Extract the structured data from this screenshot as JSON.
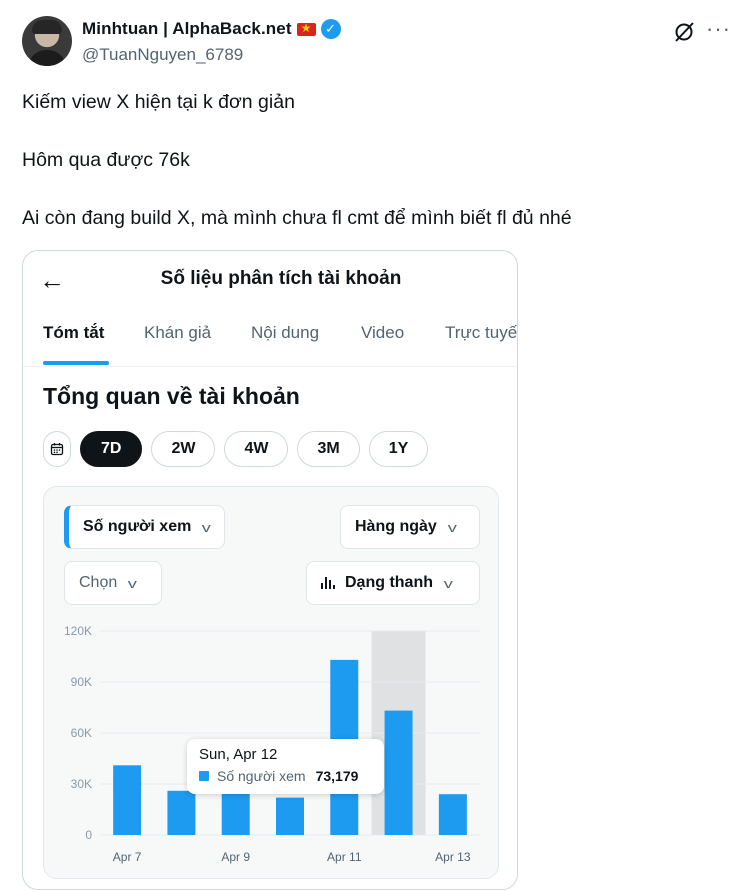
{
  "author": {
    "display_name": "Minhtuan | AlphaBack.net",
    "handle": "@TuanNguyen_6789"
  },
  "post_paragraphs": [
    "Kiếm view X hiện tại k đơn giản",
    "Hôm qua được 76k",
    "Ai còn đang build X, mà mình chưa fl cmt để mình biết fl đủ nhé"
  ],
  "icons": {
    "back": "arrow-left-icon",
    "calendar": "calendar-icon",
    "grok": "grok-icon",
    "more": "more-icon"
  },
  "media": {
    "title": "Số liệu phân tích tài khoản",
    "tabs": [
      "Tóm tắt",
      "Khán giả",
      "Nội dung",
      "Video",
      "Trực tuyế"
    ],
    "active_tab": "Tóm tắt",
    "overview_title": "Tổng quan về tài khoản",
    "ranges": [
      "7D",
      "2W",
      "4W",
      "3M",
      "1Y"
    ],
    "active_range": "7D",
    "metric_dropdown": "Số người xem",
    "interval_dropdown": "Hàng ngày",
    "compare_dropdown": "Chọn",
    "chart_type_dropdown": "Dạng thanh",
    "tooltip": {
      "date": "Sun, Apr 12",
      "label": "Số người xem",
      "value": "73,179"
    }
  },
  "colors": {
    "accent": "#1d9bf0",
    "text": "#0f1419",
    "muted": "#536471"
  },
  "chart_data": {
    "type": "bar",
    "categories": [
      "Apr 7",
      "Apr 8",
      "Apr 9",
      "Apr 10",
      "Apr 11",
      "Apr 12",
      "Apr 13"
    ],
    "x_tick_labels": [
      "Apr 7",
      "Apr 9",
      "Apr 11",
      "Apr 13"
    ],
    "y_tick_labels": [
      "120K",
      "90K",
      "60K",
      "30K",
      "0"
    ],
    "ylim": [
      0,
      120000
    ],
    "highlighted_category": "Apr 12",
    "series": [
      {
        "name": "Số người xem",
        "values": [
          41000,
          26000,
          32000,
          22000,
          103000,
          73179,
          24000
        ]
      }
    ]
  }
}
